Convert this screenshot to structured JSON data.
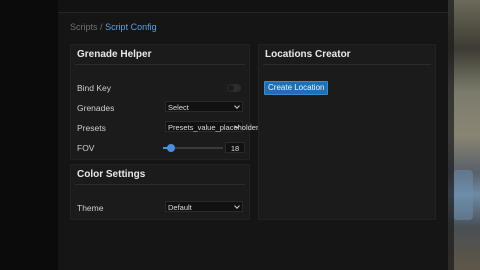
{
  "breadcrumb": {
    "parent": "Scripts",
    "separator": "/",
    "current": "Script Config"
  },
  "grenade_helper": {
    "title": "Grenade Helper",
    "bind_key": {
      "label": "Bind Key",
      "enabled": false
    },
    "grenades": {
      "label": "Grenades",
      "value": "Select"
    },
    "presets": {
      "label": "Presets",
      "value": "Presets_value_placeholder"
    },
    "fov": {
      "label": "FOV",
      "value": "18"
    }
  },
  "color_settings": {
    "title": "Color Settings",
    "theme": {
      "label": "Theme",
      "value": "Default"
    }
  },
  "locations_creator": {
    "title": "Locations Creator",
    "button": "Create Location"
  },
  "colors": {
    "accent": "#4c8fe1",
    "panel": "#1b1b1b",
    "background": "#151515"
  }
}
